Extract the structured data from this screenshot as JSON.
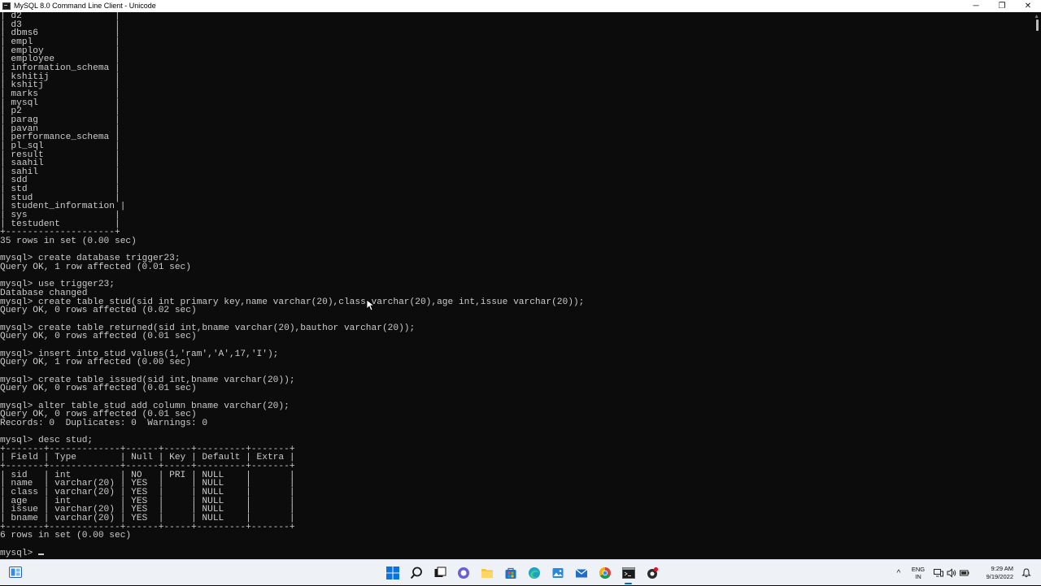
{
  "window": {
    "title": "MySQL 8.0 Command Line Client - Unicode",
    "controls": {
      "minimize": "─",
      "maximize": "❐",
      "close": "✕"
    }
  },
  "console": {
    "lines": [
      "| d2                 |",
      "| d3                 |",
      "| dbms6              |",
      "| empl               |",
      "| employ             |",
      "| employee           |",
      "| information_schema |",
      "| kshitij            |",
      "| kshitj             |",
      "| marks              |",
      "| mysql              |",
      "| p2                 |",
      "| parag              |",
      "| pavan              |",
      "| performance_schema |",
      "| pl_sql             |",
      "| result             |",
      "| saahil             |",
      "| sahil              |",
      "| sdd                |",
      "| std                |",
      "| stud               |",
      "| student_information |",
      "| sys                |",
      "| testudent          |",
      "+--------------------+",
      "35 rows in set (0.00 sec)",
      "",
      "mysql> create database trigger23;",
      "Query OK, 1 row affected (0.01 sec)",
      "",
      "mysql> use trigger23;",
      "Database changed",
      "mysql> create table stud(sid int primary key,name varchar(20),class varchar(20),age int,issue varchar(20));",
      "Query OK, 0 rows affected (0.02 sec)",
      "",
      "mysql> create table returned(sid int,bname varchar(20),bauthor varchar(20));",
      "Query OK, 0 rows affected (0.01 sec)",
      "",
      "mysql> insert into stud values(1,'ram','A',17,'I');",
      "Query OK, 1 row affected (0.00 sec)",
      "",
      "mysql> create table issued(sid int,bname varchar(20));",
      "Query OK, 0 rows affected (0.01 sec)",
      "",
      "mysql> alter table stud add column bname varchar(20);",
      "Query OK, 0 rows affected (0.01 sec)",
      "Records: 0  Duplicates: 0  Warnings: 0",
      "",
      "mysql> desc stud;",
      "+-------+-------------+------+-----+---------+-------+",
      "| Field | Type        | Null | Key | Default | Extra |",
      "+-------+-------------+------+-----+---------+-------+",
      "| sid   | int         | NO   | PRI | NULL    |       |",
      "| name  | varchar(20) | YES  |     | NULL    |       |",
      "| class | varchar(20) | YES  |     | NULL    |       |",
      "| age   | int         | YES  |     | NULL    |       |",
      "| issue | varchar(20) | YES  |     | NULL    |       |",
      "| bname | varchar(20) | YES  |     | NULL    |       |",
      "+-------+-------------+------+-----+---------+-------+",
      "6 rows in set (0.00 sec)",
      ""
    ],
    "prompt": "mysql> "
  },
  "taskbar": {
    "apps": [
      {
        "name": "start-button",
        "icon": "windows-logo-icon"
      },
      {
        "name": "search-button",
        "icon": "search-icon"
      },
      {
        "name": "task-view-button",
        "icon": "task-view-icon"
      },
      {
        "name": "chat-button",
        "icon": "chat-icon"
      },
      {
        "name": "file-explorer-button",
        "icon": "folder-icon"
      },
      {
        "name": "store-button",
        "icon": "store-icon"
      },
      {
        "name": "edge-button",
        "icon": "edge-icon"
      },
      {
        "name": "photos-button",
        "icon": "photos-icon"
      },
      {
        "name": "mail-button",
        "icon": "mail-icon"
      },
      {
        "name": "chrome-button",
        "icon": "chrome-icon"
      },
      {
        "name": "mysql-console-button",
        "icon": "console-icon"
      },
      {
        "name": "app-button",
        "icon": "app-icon"
      }
    ],
    "tray": {
      "chevron": "^",
      "lang_top": "ENG",
      "lang_bottom": "IN",
      "time": "9:29 AM",
      "date": "9/19/2022"
    }
  },
  "colors": {
    "console_bg": "#0c0c0c",
    "console_fg": "#cccccc",
    "taskbar_bg": "#eef1f6",
    "accent": "#0067c0"
  }
}
